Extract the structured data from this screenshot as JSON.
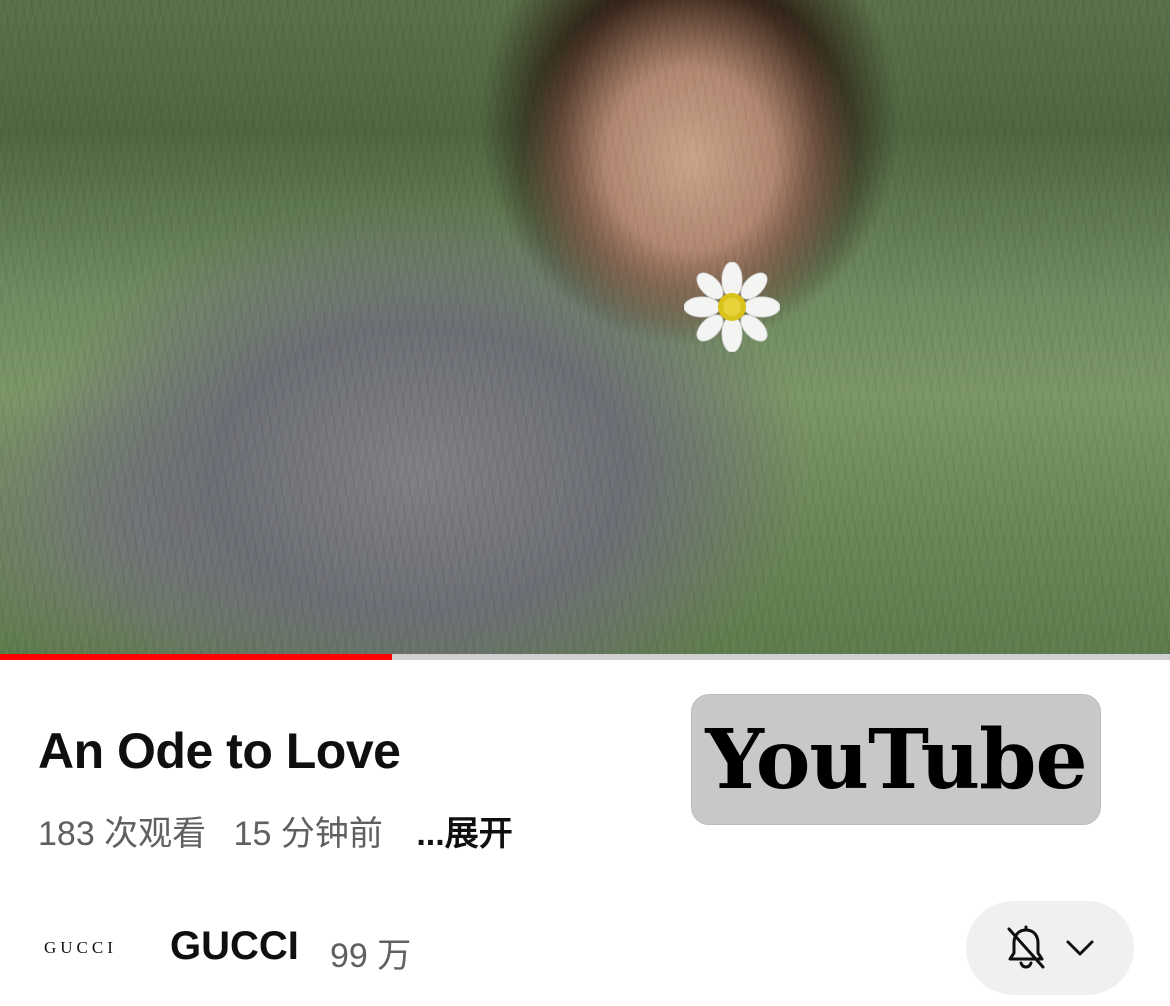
{
  "video": {
    "progress_fraction": 0.335,
    "progress_color": "#ff0000",
    "track_color": "#cfcfcf"
  },
  "info": {
    "title": "An Ode to Love",
    "views": "183 次观看",
    "time_ago": "15 分钟前",
    "expand_label": "...展开"
  },
  "badge": {
    "text": "YouTube"
  },
  "channel": {
    "logo_text": "GUCCI",
    "name": "GUCCI",
    "subscribers": "99 万",
    "notification_icon": "bell-off-icon",
    "dropdown_icon": "chevron-down-icon"
  }
}
